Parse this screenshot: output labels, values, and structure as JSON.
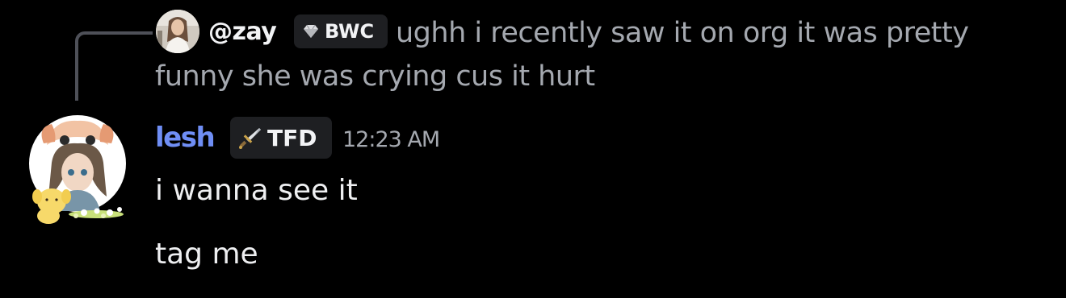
{
  "reply": {
    "username": "@zay",
    "tag_label": "BWC",
    "tag_icon": "diamond-icon",
    "text": "ughh i recently saw it on org it was pretty funny she was crying cus it hurt"
  },
  "message": {
    "username": "lesh",
    "tag_label": "TFD",
    "tag_icon": "sword-icon",
    "timestamp": "12:23 AM",
    "lines": [
      "i wanna see it",
      "tag me"
    ]
  },
  "colors": {
    "background": "#000000",
    "username_accent": "#6f8ef5",
    "muted_text": "#a4a8af",
    "tag_background": "#1e1f22"
  }
}
